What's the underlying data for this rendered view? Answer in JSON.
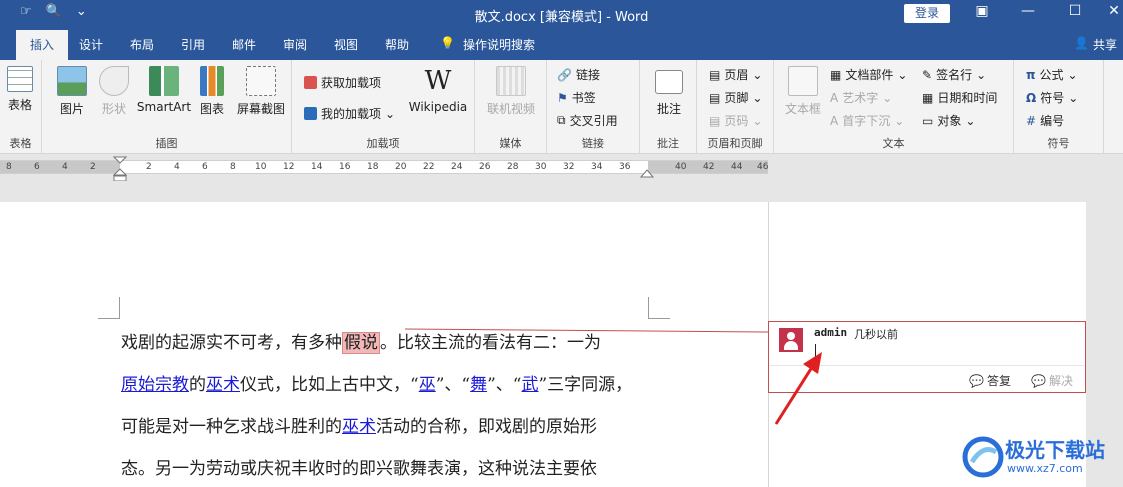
{
  "title_bar": {
    "title": "散文.docx [兼容模式] - Word",
    "login": "登录",
    "qat_icons": [
      "touch-mode-icon",
      "print-preview-icon",
      "customize-icon"
    ],
    "window_buttons": [
      "ribbon-display-icon",
      "minimize-icon",
      "maximize-icon",
      "close-icon"
    ]
  },
  "tabs": {
    "items": [
      "插入",
      "设计",
      "布局",
      "引用",
      "邮件",
      "审阅",
      "视图",
      "帮助"
    ],
    "active": "插入",
    "tell_me": "操作说明搜索",
    "share": "共享"
  },
  "ribbon": {
    "groups": {
      "table": {
        "label": "表格",
        "btn": "表格"
      },
      "illustrations": {
        "label": "插图",
        "btns": [
          "图片",
          "形状",
          "SmartArt",
          "图表",
          "屏幕截图"
        ]
      },
      "addins": {
        "label": "加载项",
        "get": "获取加载项",
        "mine": "我的加载项",
        "wiki": "Wikipedia",
        "wiki_logo": "W"
      },
      "media": {
        "label": "媒体",
        "btn": "联机视频"
      },
      "links": {
        "label": "链接",
        "items": [
          "链接",
          "书签",
          "交叉引用"
        ]
      },
      "comments": {
        "label": "批注",
        "btn": "批注"
      },
      "header_footer": {
        "label": "页眉和页脚",
        "items": [
          "页眉",
          "页脚",
          "页码"
        ]
      },
      "text": {
        "label": "文本",
        "textbox": "文本框",
        "items_a": [
          "文档部件",
          "艺术字",
          "首字下沉"
        ],
        "items_b": [
          "签名行",
          "日期和时间",
          "对象"
        ]
      },
      "symbols": {
        "label": "符号",
        "items": [
          "公式",
          "符号",
          "编号"
        ]
      }
    }
  },
  "ruler": {
    "left_nums": [
      "8",
      "6",
      "4",
      "2"
    ],
    "right_nums": [
      "2",
      "4",
      "6",
      "8",
      "10",
      "12",
      "14",
      "16",
      "18",
      "20",
      "22",
      "24",
      "26",
      "28",
      "30",
      "32",
      "34",
      "36",
      "40",
      "42",
      "44",
      "46"
    ]
  },
  "document": {
    "lines": [
      [
        {
          "t": "戏剧的起源实不可考，有多种",
          "s": "n"
        },
        {
          "t": "假说",
          "s": "hl"
        },
        {
          "t": "。比较主流的看法有二：一为",
          "s": "n"
        }
      ],
      [
        {
          "t": "原始宗教",
          "s": "link"
        },
        {
          "t": "的",
          "s": "n"
        },
        {
          "t": "巫术",
          "s": "link"
        },
        {
          "t": "仪式，比如上古中文，“",
          "s": "n"
        },
        {
          "t": "巫",
          "s": "link"
        },
        {
          "t": "”、“",
          "s": "n"
        },
        {
          "t": "舞",
          "s": "link"
        },
        {
          "t": "”、“",
          "s": "n"
        },
        {
          "t": "武",
          "s": "link"
        },
        {
          "t": "”三字同源，",
          "s": "n"
        }
      ],
      [
        {
          "t": "可能是对一种乞求战斗胜利的",
          "s": "n"
        },
        {
          "t": "巫术",
          "s": "link"
        },
        {
          "t": "活动的合称，即戏剧的原始形",
          "s": "n"
        }
      ],
      [
        {
          "t": "态。另一为劳动或庆祝丰收时的即兴歌舞表演，这种说法主要依",
          "s": "n"
        }
      ]
    ]
  },
  "comment": {
    "author": "admin",
    "time": "几秒以前",
    "reply": "答复",
    "resolve": "解决"
  },
  "watermark": {
    "name": "极光下载站",
    "url": "www.xz7.com"
  }
}
